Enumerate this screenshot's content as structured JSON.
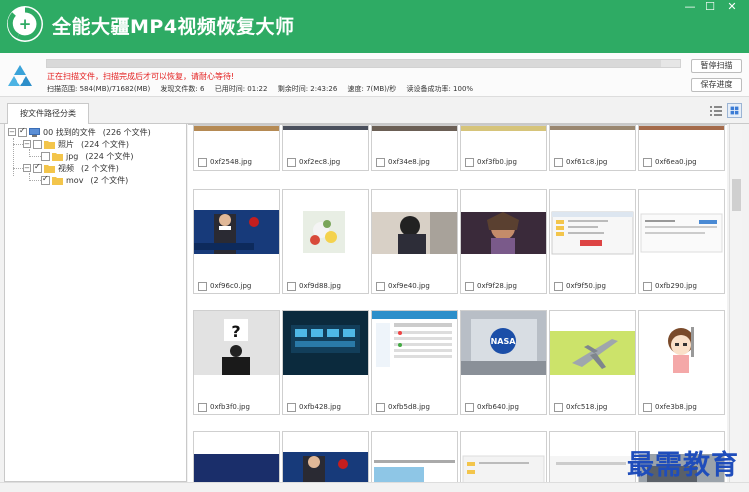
{
  "app": {
    "title": "全能大疆MP4视频恢复大师"
  },
  "status": {
    "warning": "正在扫描文件，扫描完成后才可以恢复，请耐心等待!",
    "progress": 0.97,
    "scan_range": "扫描范围: 584(MB)/71682(MB)",
    "files_found": "发现文件数: 6",
    "elapsed": "已用时间: 01:22",
    "remaining": "剩余时间: 2:43:26",
    "speed": "速度: 7(MB)/秒",
    "read_success": "读设备成功率: 100%"
  },
  "buttons": {
    "pause": "暂停扫描",
    "save": "保存进度"
  },
  "tabs": [
    {
      "label": "按文件路径分类"
    }
  ],
  "tree": {
    "root": {
      "label": "00 找到的文件",
      "count": "(226 个文件)"
    },
    "photos": {
      "label": "照片",
      "count": "(224 个文件)"
    },
    "jpg": {
      "label": "jpg",
      "count": "(224 个文件)"
    },
    "video": {
      "label": "视频",
      "count": "(2 个文件)"
    },
    "mov": {
      "label": "mov",
      "count": "(2 个文件)"
    }
  },
  "thumb_rows": [
    [
      "0xf2548.jpg",
      "0xf2ec8.jpg",
      "0xf34e8.jpg",
      "0xf3fb0.jpg",
      "0xf61c8.jpg",
      "0xf6ea0.jpg"
    ],
    [
      "0xf96c0.jpg",
      "0xf9d88.jpg",
      "0xf9e40.jpg",
      "0xf9f28.jpg",
      "0xf9f50.jpg",
      "0xfb290.jpg"
    ],
    [
      "0xfb3f0.jpg",
      "0xfb428.jpg",
      "0xfb5d8.jpg",
      "0xfb640.jpg",
      "0xfc518.jpg",
      "0xfe3b8.jpg"
    ]
  ],
  "watermark": "最需教育",
  "colors": {
    "titlebar": "#2eab64",
    "warning": "#e42020",
    "watermark": "#1f4dbb"
  },
  "icons": [
    "recycle-logo-icon",
    "minimize-icon",
    "maximize-icon",
    "close-icon",
    "recycle-icon",
    "list-view-icon",
    "grid-view-icon",
    "folder-icon"
  ]
}
